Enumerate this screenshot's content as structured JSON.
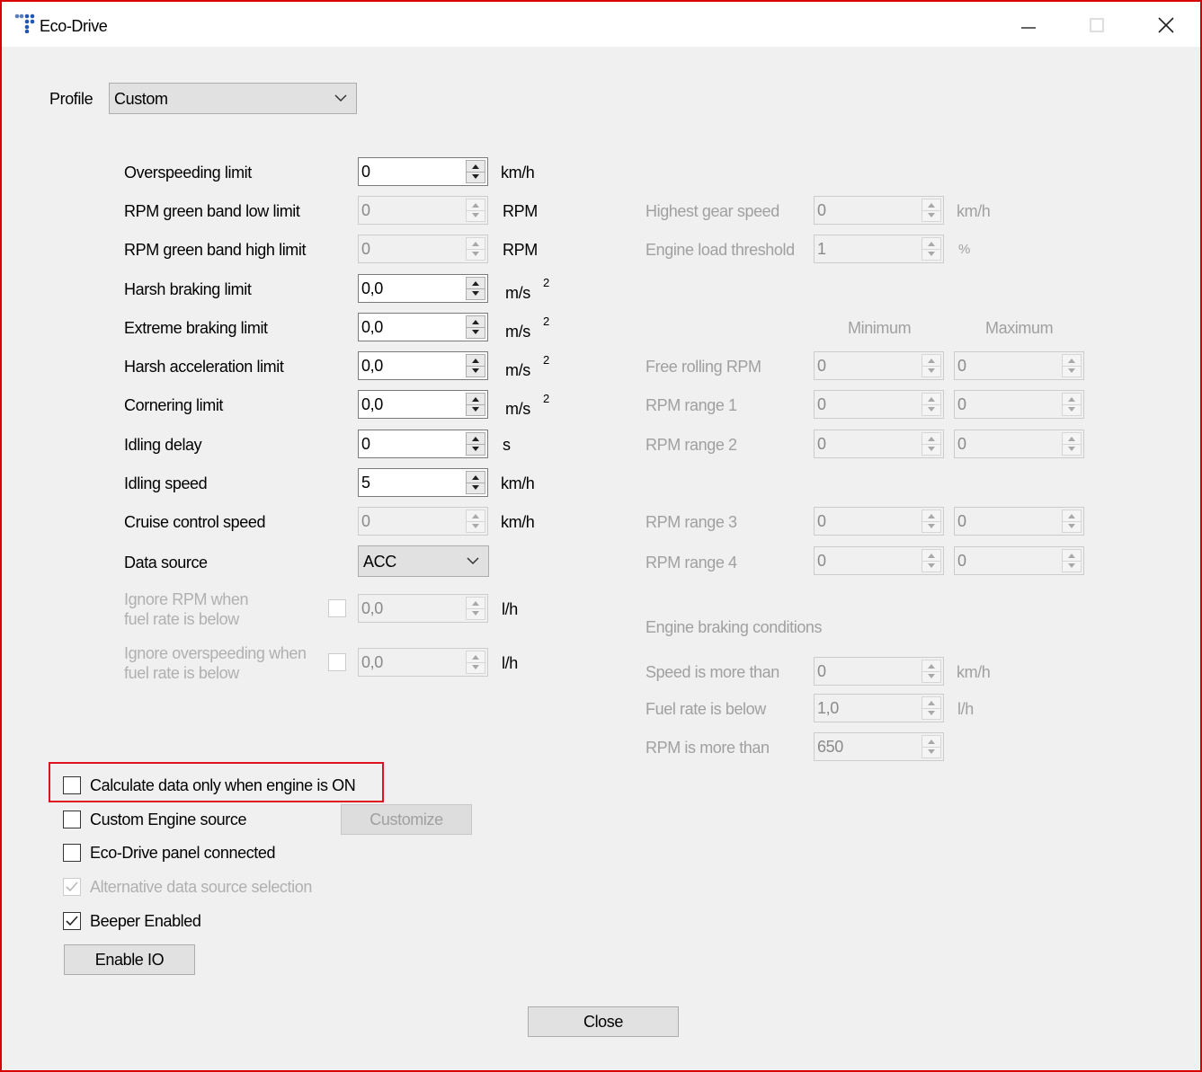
{
  "window": {
    "title": "Eco-Drive"
  },
  "profile": {
    "label": "Profile",
    "value": "Custom"
  },
  "left": {
    "overspeeding": {
      "label": "Overspeeding limit",
      "value": "0",
      "unit": "km/h"
    },
    "rpm_low": {
      "label": "RPM green band low limit",
      "value": "0",
      "unit": "RPM"
    },
    "rpm_high": {
      "label": "RPM green band high limit",
      "value": "0",
      "unit": "RPM"
    },
    "harsh_braking": {
      "label": "Harsh braking limit",
      "value": "0,0",
      "unit": "m/s",
      "unit_sup": "2"
    },
    "extreme_braking": {
      "label": "Extreme braking limit",
      "value": "0,0",
      "unit": "m/s",
      "unit_sup": "2"
    },
    "harsh_accel": {
      "label": "Harsh acceleration limit",
      "value": "0,0",
      "unit": "m/s",
      "unit_sup": "2"
    },
    "cornering": {
      "label": "Cornering limit",
      "value": "0,0",
      "unit": "m/s",
      "unit_sup": "2"
    },
    "idling_delay": {
      "label": "Idling delay",
      "value": "0",
      "unit": "s"
    },
    "idling_speed": {
      "label": "Idling speed",
      "value": "5",
      "unit": "km/h"
    },
    "cruise_speed": {
      "label": "Cruise control speed",
      "value": "0",
      "unit": "km/h"
    },
    "data_source": {
      "label": "Data source",
      "value": "ACC"
    },
    "ignore_rpm": {
      "label_line1": "Ignore RPM when",
      "label_line2": "fuel rate is below",
      "value": "0,0",
      "unit": "l/h"
    },
    "ignore_overspeed": {
      "label_line1": "Ignore overspeeding when",
      "label_line2": "fuel rate is below",
      "value": "0,0",
      "unit": "l/h"
    }
  },
  "right": {
    "highest_gear": {
      "label": "Highest gear speed",
      "value": "0",
      "unit": "km/h"
    },
    "engine_load": {
      "label": "Engine load threshold",
      "value": "1",
      "unit": "%"
    },
    "col_min": "Minimum",
    "col_max": "Maximum",
    "free_rolling": {
      "label": "Free rolling RPM",
      "min": "0",
      "max": "0"
    },
    "rpm_range_1": {
      "label": "RPM range 1",
      "min": "0",
      "max": "0"
    },
    "rpm_range_2": {
      "label": "RPM range 2",
      "min": "0",
      "max": "0"
    },
    "rpm_range_3": {
      "label": "RPM range 3",
      "min": "0",
      "max": "0"
    },
    "rpm_range_4": {
      "label": "RPM range 4",
      "min": "0",
      "max": "0"
    },
    "engine_braking_title": "Engine braking conditions",
    "speed_more": {
      "label": "Speed is more than",
      "value": "0",
      "unit": "km/h"
    },
    "fuel_below": {
      "label": "Fuel rate is below",
      "value": "1,0",
      "unit": "l/h"
    },
    "rpm_more": {
      "label": "RPM is more than",
      "value": "650"
    }
  },
  "options": {
    "calc_engine_on": {
      "label": "Calculate data only when engine is ON",
      "checked": false
    },
    "custom_engine": {
      "label": "Custom Engine source",
      "checked": false
    },
    "customize_button": "Customize",
    "panel_connected": {
      "label": "Eco-Drive panel connected",
      "checked": false
    },
    "alt_source": {
      "label": "Alternative data source selection",
      "checked": true
    },
    "beeper": {
      "label": "Beeper Enabled",
      "checked": true
    },
    "enable_io_button": "Enable IO"
  },
  "footer": {
    "close_button": "Close"
  },
  "colors": {
    "highlight": "#e0141e",
    "window_border": "#d90000"
  },
  "icons": [
    "app-icon",
    "minimize-icon",
    "maximize-icon",
    "close-icon",
    "chevron-down-icon",
    "spin-arrows-icon",
    "check-icon"
  ]
}
